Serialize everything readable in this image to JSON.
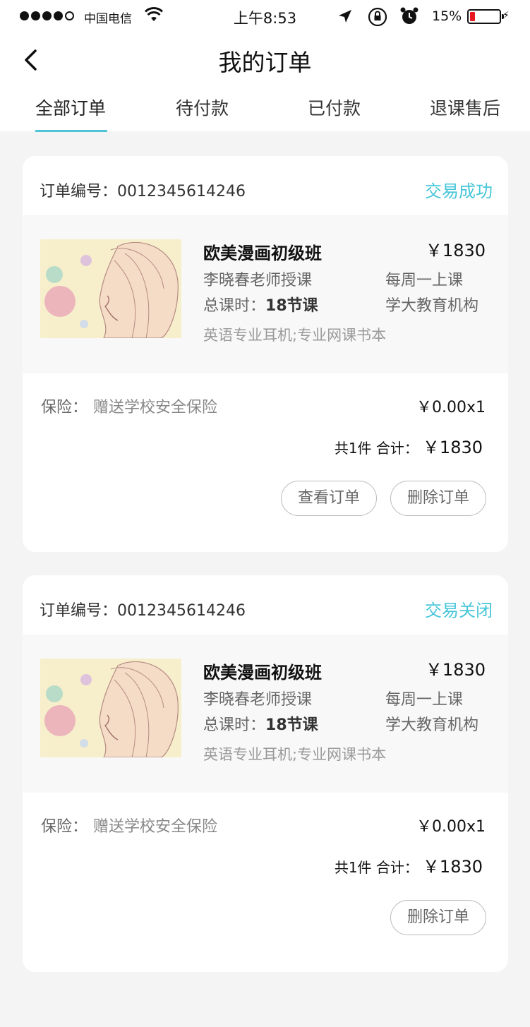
{
  "status_bar": {
    "carrier": "中国电信",
    "time": "上午8:53",
    "battery_pct": "15%",
    "battery_level": 0.15,
    "icons": [
      "signal-dots",
      "wifi-icon",
      "location-arrow-icon",
      "rotation-lock-icon",
      "alarm-icon",
      "battery-icon"
    ]
  },
  "nav": {
    "title": "我的订单",
    "back_icon": "chevron-left-icon"
  },
  "tabs": [
    {
      "label": "全部订单",
      "active": true
    },
    {
      "label": "待付款",
      "active": false
    },
    {
      "label": "已付款",
      "active": false
    },
    {
      "label": "退课售后",
      "active": false
    }
  ],
  "accent_color": "#46c6d8",
  "orders": [
    {
      "order_label": "订单编号：0012345614246",
      "status": "交易成功",
      "course_name": "欧美漫画初级班",
      "price": "￥1830",
      "teacher": "李晓春老师授课",
      "frequency": "每周一上课",
      "hours_label": "总课时：",
      "hours_value": "18节课",
      "org": "学大教育机构",
      "extras": "英语专业耳机;专业网课书本",
      "insurance_label": "保险：",
      "insurance_value": "赠送学校安全保险",
      "insurance_price": "￥0.00x1",
      "total_label": "共1件 合计：",
      "total_amount": "￥1830",
      "buttons": [
        "查看订单",
        "删除订单"
      ]
    },
    {
      "order_label": "订单编号：0012345614246",
      "status": "交易关闭",
      "course_name": "欧美漫画初级班",
      "price": "￥1830",
      "teacher": "李晓春老师授课",
      "frequency": "每周一上课",
      "hours_label": "总课时：",
      "hours_value": "18节课",
      "org": "学大教育机构",
      "extras": "英语专业耳机;专业网课书本",
      "insurance_label": "保险：",
      "insurance_value": "赠送学校安全保险",
      "insurance_price": "￥0.00x1",
      "total_label": "共1件 合计：",
      "total_amount": "￥1830",
      "buttons": [
        "删除订单"
      ]
    }
  ]
}
